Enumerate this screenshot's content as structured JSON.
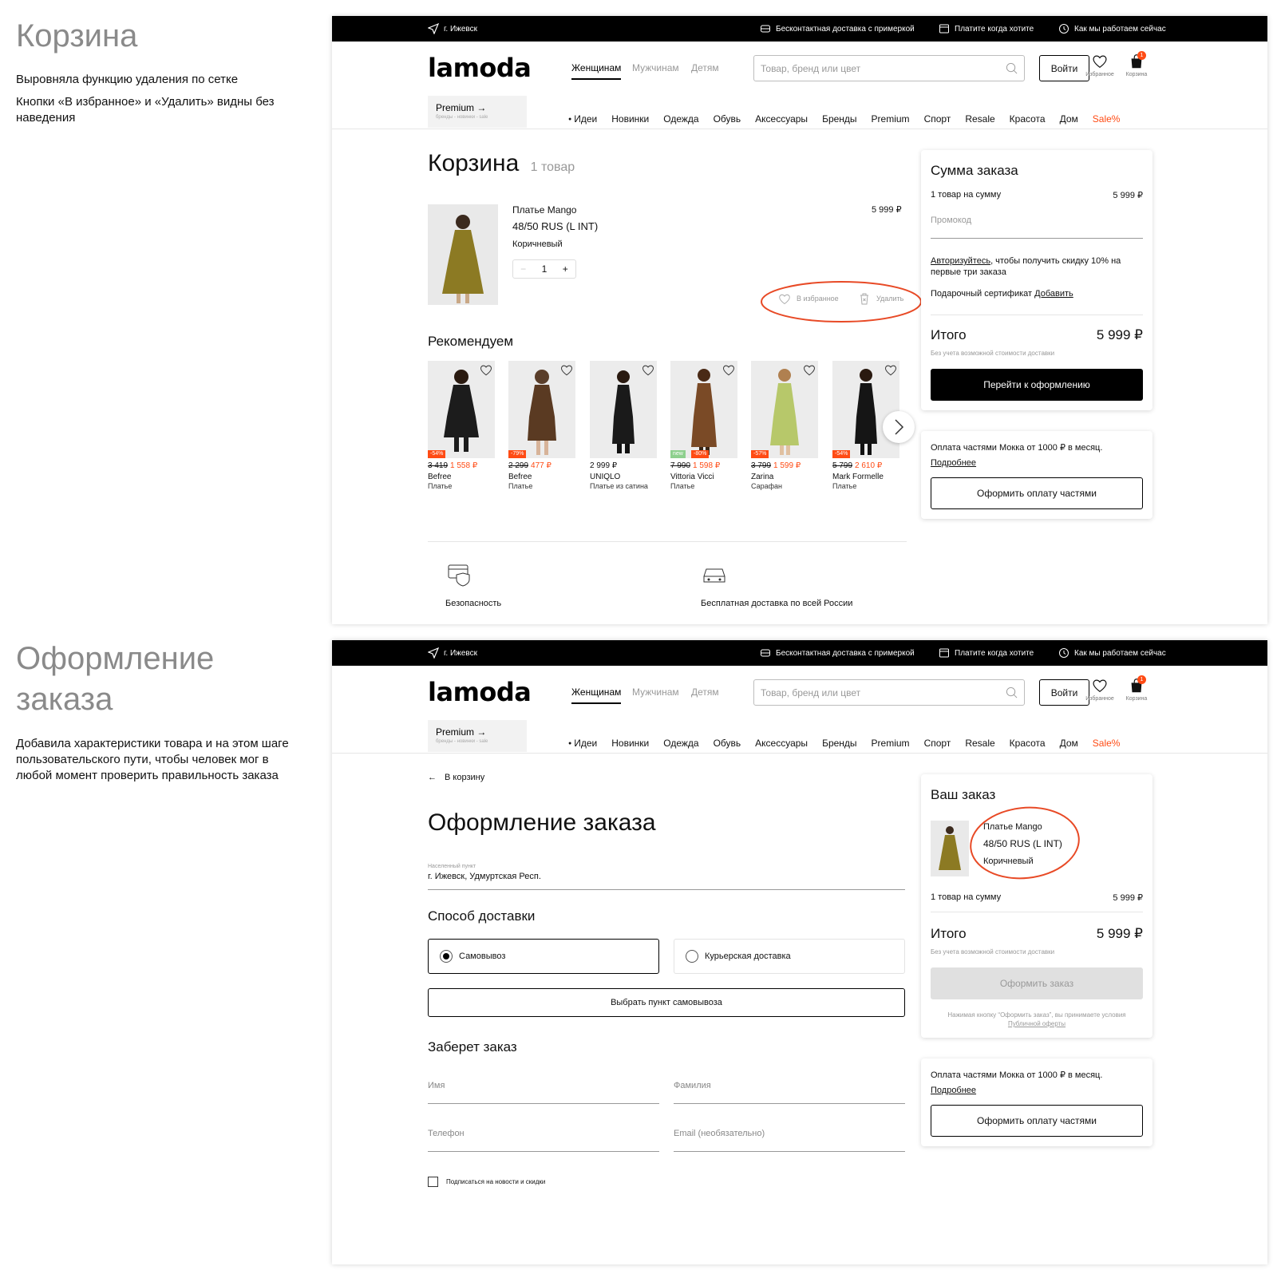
{
  "notes": {
    "cart": {
      "title": "Корзина",
      "lines": [
        "Выровняла функцию удаления по сетке",
        "Кнопки «В избранное» и «Удалить» видны без наведения"
      ]
    },
    "checkout": {
      "title": "Оформление заказа",
      "text": "Добавила характеристики товара и на этом шаге пользовательского пути, чтобы человек мог в любой момент проверить правильность заказа"
    }
  },
  "topbar": {
    "city": "г. Ижевск",
    "delivery": "Бесконтактная доставка с примеркой",
    "pay": "Платите когда хотите",
    "how": "Как мы работаем сейчас"
  },
  "header": {
    "logo": "lamoda",
    "genders": [
      "Женщинам",
      "Мужчинам",
      "Детям"
    ],
    "search_placeholder": "Товар, бренд или цвет",
    "login": "Войти",
    "favorites": "Избранное",
    "cart": "Корзина",
    "cart_count": "1",
    "premium_title": "Premium",
    "premium_sub": "бренды - новинки - sale",
    "menu": [
      "Идеи",
      "Новинки",
      "Одежда",
      "Обувь",
      "Аксессуары",
      "Бренды",
      "Premium",
      "Спорт",
      "Resale",
      "Красота",
      "Дом",
      "Sale%"
    ]
  },
  "cart": {
    "title": "Корзина",
    "count": "1 товар",
    "item": {
      "name": "Платье Mango",
      "size": "48/50 RUS (L INT)",
      "color": "Коричневый",
      "qty": "1",
      "minus": "−",
      "plus": "+",
      "price": "5 999 ₽",
      "favorite": "В избранное",
      "delete": "Удалить"
    },
    "recommend_title": "Рекомендуем",
    "recommend": [
      {
        "discount": "-54%",
        "old": "3 419",
        "new": "1 558 ₽",
        "brand": "Befree",
        "cat": "Платье",
        "color": "#1c1c1c"
      },
      {
        "discount": "-79%",
        "old": "2 299",
        "new": "477 ₽",
        "brand": "Befree",
        "cat": "Платье",
        "color": "#5a3a22"
      },
      {
        "discount": "",
        "old": "",
        "price": "2 999 ₽",
        "brand": "UNIQLO",
        "cat": "Платье из сатина",
        "color": "#1a1a1a"
      },
      {
        "badge_new": "new",
        "discount": "-80%",
        "old": "7 990",
        "new": "1 598 ₽",
        "brand": "Vittoria Vicci",
        "cat": "Платье",
        "color": "#7a4a26"
      },
      {
        "discount": "-57%",
        "old": "3 799",
        "new": "1 599 ₽",
        "brand": "Zarina",
        "cat": "Сарафан",
        "color": "#b7c86a"
      },
      {
        "discount": "-54%",
        "old": "5 799",
        "new": "2 610 ₽",
        "brand": "Mark Formelle",
        "cat": "Платье",
        "color": "#151515"
      }
    ],
    "features": [
      "Безопасность",
      "Бесплатная доставка по всей России"
    ],
    "summary": {
      "title": "Сумма заказа",
      "items_label": "1 товар на сумму",
      "items_sum": "5 999 ₽",
      "promo": "Промокод",
      "auth_link": "Авторизуйтесь",
      "auth_text": ", чтобы получить скидку 10% на первые три заказа",
      "gift_label": "Подарочный сертификат",
      "gift_link": "Добавить",
      "total_label": "Итого",
      "total": "5 999 ₽",
      "total_note": "Без учета возможной стоимости доставки",
      "checkout": "Перейти к оформлению"
    },
    "mokka": {
      "text": "Оплата частями Мокка от 1000 ₽ в месяц.",
      "more": "Подробнее",
      "button": "Оформить оплату частями"
    }
  },
  "checkout": {
    "back": "В корзину",
    "title": "Оформление заказа",
    "locality_label": "Населенный пункт",
    "locality": "г. Ижевск, Удмуртская Респ.",
    "delivery_title": "Способ доставки",
    "pickup": "Самовывоз",
    "courier": "Курьерская доставка",
    "choose_point": "Выбрать пункт самовывоза",
    "receiver_title": "Заберет заказ",
    "first_name": "Имя",
    "last_name": "Фамилия",
    "phone": "Телефон",
    "email": "Email (необязательно)",
    "subscribe": "Подписаться на новости и скидки",
    "order": {
      "title": "Ваш заказ",
      "name": "Платье Mango",
      "size": "48/50 RUS (L INT)",
      "color": "Коричневый",
      "items_label": "1 товар на сумму",
      "items_sum": "5 999 ₽",
      "total_label": "Итого",
      "total": "5 999 ₽",
      "total_note": "Без учета возможной стоимости доставки",
      "button": "Оформить заказ",
      "legal": "Нажимая кнопку “Оформить заказ”, вы принимаете условия",
      "legal_link": "Публичной оферты"
    },
    "mokka": {
      "text": "Оплата частями Мокка от 1000 ₽ в месяц.",
      "more": "Подробнее",
      "button": "Оформить оплату частями"
    }
  },
  "colors": {
    "accent": "#ff4b14",
    "black": "#000000",
    "annotation": "#e84a26"
  }
}
